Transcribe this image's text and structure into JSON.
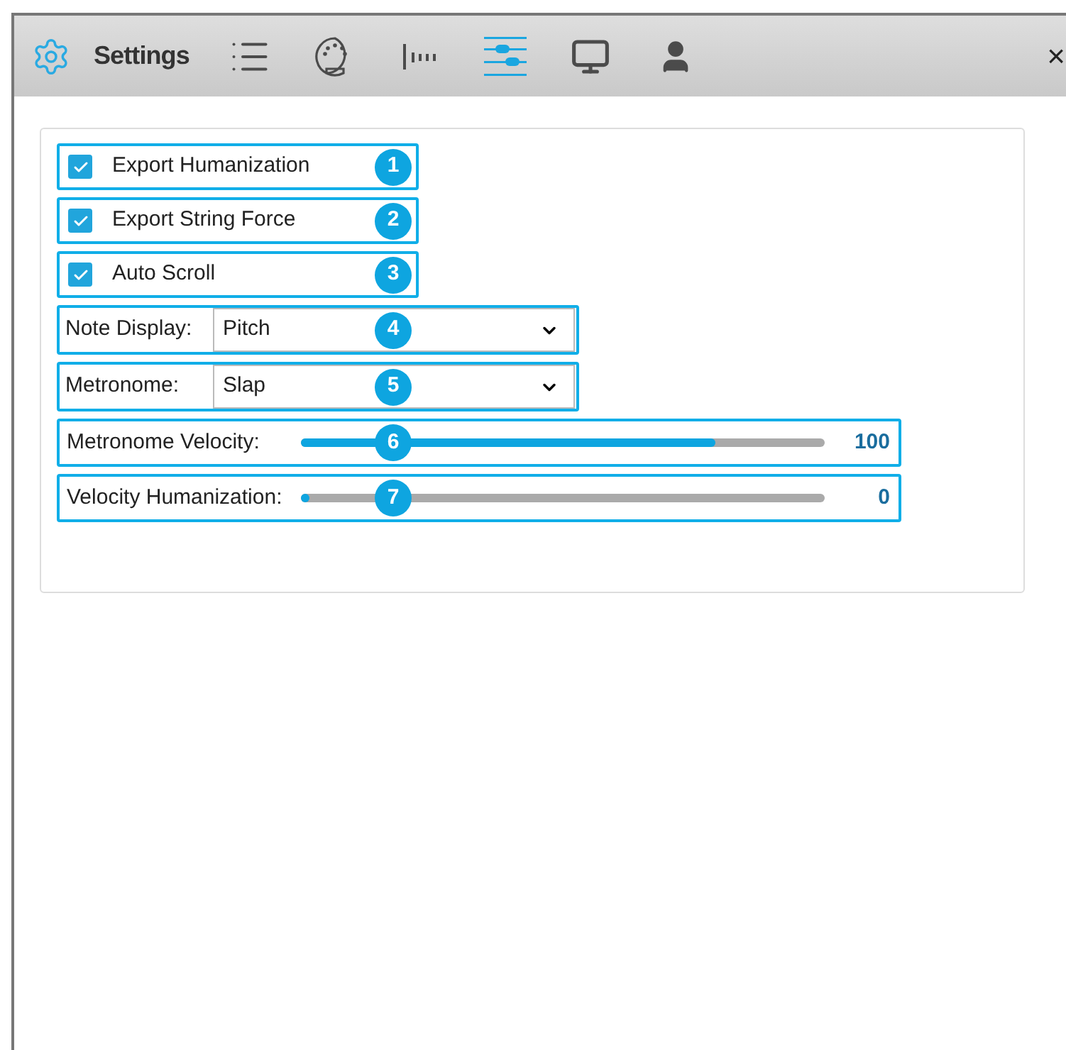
{
  "window": {
    "title": "Settings",
    "close": "×"
  },
  "tabs": [
    {
      "kind": "list",
      "selected": false
    },
    {
      "kind": "midi",
      "selected": false
    },
    {
      "kind": "bars",
      "selected": false
    },
    {
      "kind": "sliders",
      "selected": true
    },
    {
      "kind": "monitor",
      "selected": false
    },
    {
      "kind": "person",
      "selected": false
    }
  ],
  "settings": [
    {
      "kind": "checkbox",
      "label": "Export Humanization",
      "checked": true,
      "badge": "1"
    },
    {
      "kind": "checkbox",
      "label": "Export String Force",
      "checked": true,
      "badge": "2"
    },
    {
      "kind": "checkbox",
      "label": "Auto Scroll",
      "checked": true,
      "badge": "3"
    },
    {
      "kind": "select",
      "label": "Note Display:",
      "value": "Pitch",
      "badge": "4"
    },
    {
      "kind": "select",
      "label": "Metronome:",
      "value": "Slap",
      "badge": "5"
    },
    {
      "kind": "slider",
      "label": "Metronome Velocity:",
      "level": 0.79,
      "reading": "100",
      "badge": "6"
    },
    {
      "kind": "slider",
      "label": "Velocity Humanization:",
      "level": 0.01,
      "reading": "0",
      "badge": "7"
    }
  ]
}
